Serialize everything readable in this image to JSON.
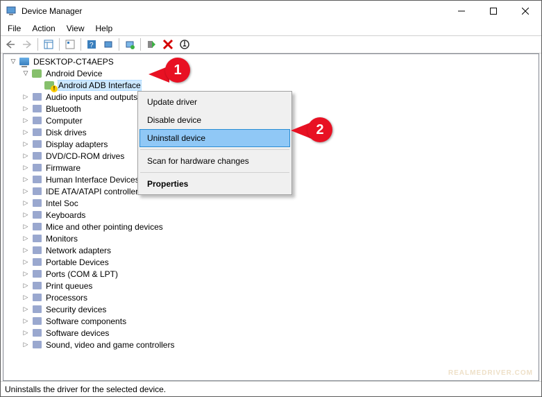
{
  "window": {
    "title": "Device Manager"
  },
  "menu": {
    "file": "File",
    "action": "Action",
    "view": "View",
    "help": "Help"
  },
  "tree": {
    "root": "DESKTOP-CT4AEPS",
    "androidCategory": "Android Device",
    "androidItem": "Android ADB Interface",
    "items": [
      "Audio inputs and outputs",
      "Bluetooth",
      "Computer",
      "Disk drives",
      "Display adapters",
      "DVD/CD-ROM drives",
      "Firmware",
      "Human Interface Devices",
      "IDE ATA/ATAPI controllers",
      "Intel Soc",
      "Keyboards",
      "Mice and other pointing devices",
      "Monitors",
      "Network adapters",
      "Portable Devices",
      "Ports (COM & LPT)",
      "Print queues",
      "Processors",
      "Security devices",
      "Software components",
      "Software devices",
      "Sound, video and game controllers"
    ]
  },
  "context": {
    "update": "Update driver",
    "disable": "Disable device",
    "uninstall": "Uninstall device",
    "scan": "Scan for hardware changes",
    "properties": "Properties"
  },
  "callouts": {
    "one": "1",
    "two": "2"
  },
  "status": "Uninstalls the driver for the selected device.",
  "watermark": "REALMEDRIVER.COM"
}
